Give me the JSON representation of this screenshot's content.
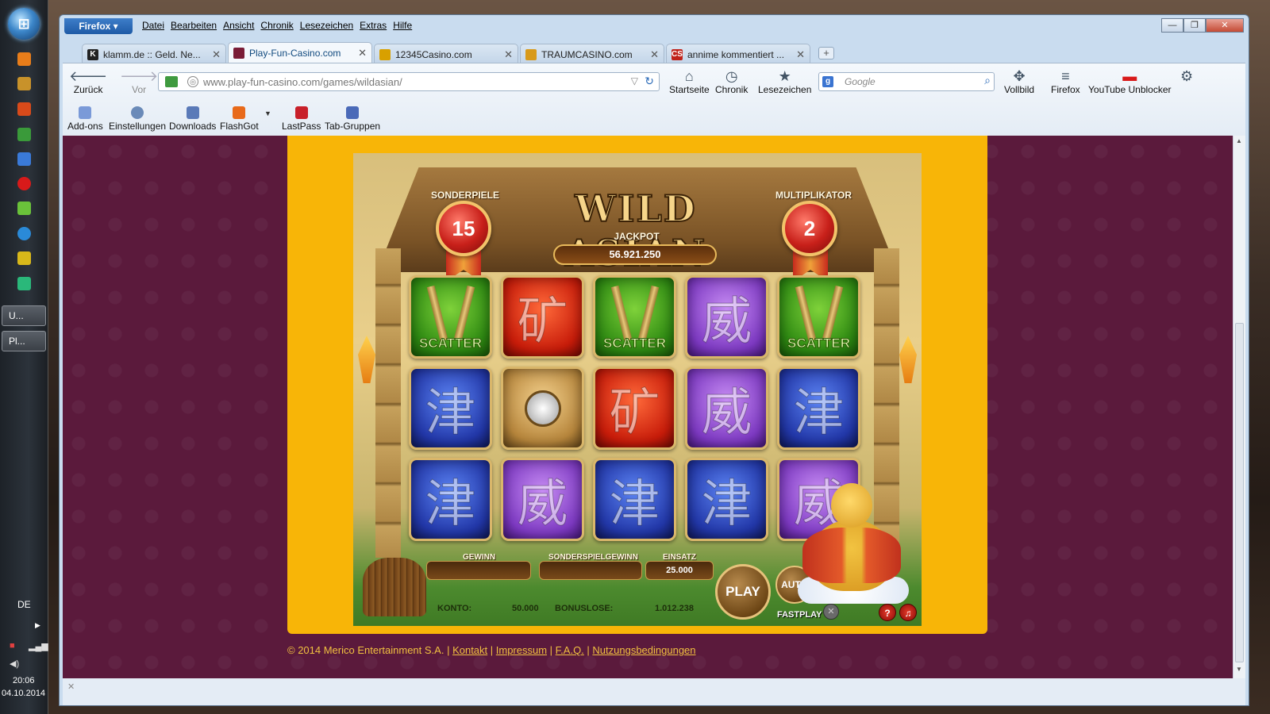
{
  "taskbar": {
    "tasks": [
      {
        "label": "U...",
        "icon": "gamepad-icon"
      },
      {
        "label": "Pl...",
        "icon": "firefox-icon"
      }
    ],
    "language": "DE",
    "clock_time": "20:06",
    "clock_date": "04.10.2014"
  },
  "browser": {
    "app_button": "Firefox",
    "menu": [
      "Datei",
      "Bearbeiten",
      "Ansicht",
      "Chronik",
      "Lesezeichen",
      "Extras",
      "Hilfe"
    ],
    "tabs": [
      {
        "label": "klamm.de :: Geld. Ne...",
        "favicon_text": "K",
        "favicon_color": "#222222",
        "active": false
      },
      {
        "label": "Play-Fun-Casino.com",
        "favicon_text": "",
        "favicon_color": "#7a1c36",
        "active": true
      },
      {
        "label": "12345Casino.com",
        "favicon_text": "",
        "favicon_color": "#d8a000",
        "active": false
      },
      {
        "label": "TRAUMCASINO.com",
        "favicon_text": "",
        "favicon_color": "#d89a1a",
        "active": false
      },
      {
        "label": "annime kommentiert ...",
        "favicon_text": "CS",
        "favicon_color": "#c0221a",
        "active": false
      }
    ],
    "nav": {
      "back": "Zurück",
      "forward": "Vor",
      "url_host": "www.play-fun-casino.com",
      "url_path": "/games/wildasian/",
      "search_placeholder": "Google",
      "home": "Startseite",
      "history": "Chronik",
      "bookmarks": "Lesezeichen",
      "fullscreen": "Vollbild",
      "firefox_menu": "Firefox",
      "youtube_unblocker": "YouTube Unblocker"
    },
    "toolbar": {
      "addons": "Add-ons",
      "settings": "Einstellungen",
      "downloads": "Downloads",
      "flashgot": "FlashGot",
      "lastpass": "LastPass",
      "tab_groups": "Tab-Gruppen"
    }
  },
  "game": {
    "title": "WILD ASIAN",
    "free_spins_label": "SONDERPIELE",
    "free_spins_value": "15",
    "multiplier_label": "MULTIPLIKATOR",
    "multiplier_value": "2",
    "jackpot_label": "JACKPOT",
    "jackpot_value": "56.921.250",
    "reels": [
      [
        {
          "type": "scatter",
          "color": "green",
          "label": "SCATTER"
        },
        {
          "type": "glyph",
          "color": "red",
          "glyph": "矿"
        },
        {
          "type": "scatter",
          "color": "green",
          "label": "SCATTER"
        },
        {
          "type": "glyph",
          "color": "purple",
          "glyph": "威"
        },
        {
          "type": "scatter",
          "color": "green",
          "label": "SCATTER"
        }
      ],
      [
        {
          "type": "glyph",
          "color": "blue",
          "glyph": "津"
        },
        {
          "type": "gong",
          "color": "gold"
        },
        {
          "type": "glyph",
          "color": "red",
          "glyph": "矿"
        },
        {
          "type": "glyph",
          "color": "purple",
          "glyph": "威"
        },
        {
          "type": "glyph",
          "color": "blue",
          "glyph": "津"
        }
      ],
      [
        {
          "type": "glyph",
          "color": "blue",
          "glyph": "津"
        },
        {
          "type": "glyph",
          "color": "purple",
          "glyph": "威"
        },
        {
          "type": "glyph",
          "color": "blue",
          "glyph": "津"
        },
        {
          "type": "glyph",
          "color": "blue",
          "glyph": "津"
        },
        {
          "type": "glyph",
          "color": "purple",
          "glyph": "威"
        }
      ]
    ],
    "win_label": "GEWINN",
    "win_value": "",
    "bonus_win_label": "SONDERSPIELGEWINN",
    "bonus_win_value": "",
    "bet_label": "EINSATZ",
    "bet_value": "25.000",
    "account_label": "KONTO:",
    "account_value": "50.000",
    "bonus_lots_label": "BONUSLOSE:",
    "bonus_lots_value": "1.012.238",
    "play_label": "PLAY",
    "auto_label": "AUTO",
    "fastplay_label": "FASTPLAY",
    "help_icon": "question-icon",
    "sound_icon": "music-note-icon"
  },
  "footer": {
    "copyright": "© 2014 Merico Entertainment S.A.",
    "links": [
      "Kontakt",
      "Impressum",
      "F.A.Q.",
      "Nutzungsbedingungen"
    ]
  }
}
